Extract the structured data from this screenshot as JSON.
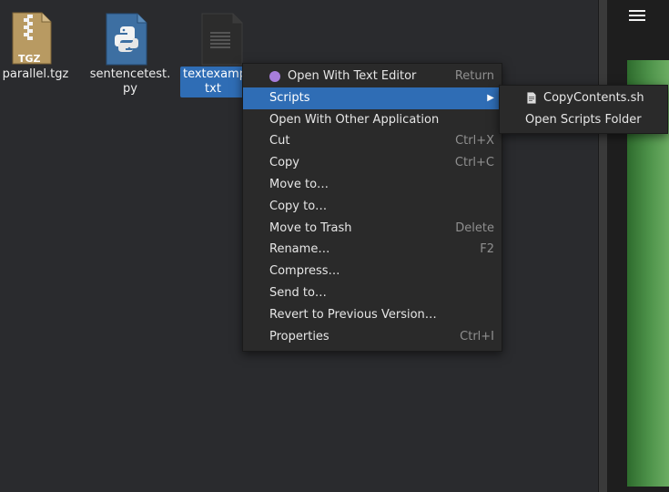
{
  "desktop": {
    "files": [
      {
        "name": "parallel.tgz",
        "badge": "TGZ",
        "icon": "archive-icon"
      },
      {
        "name": "sentencetest.\npy",
        "icon": "python-file-icon"
      },
      {
        "name": "textexamp\ntxt",
        "icon": "text-file-icon",
        "selected": true
      }
    ]
  },
  "top_right_menu_icon": "hamburger-icon",
  "context_menu": {
    "items": [
      {
        "label": "Open With Text Editor",
        "shortcut": "Return",
        "icon": "text-editor-icon"
      },
      {
        "label": "Scripts",
        "submenu": true,
        "active": true
      },
      {
        "label": "Open With Other Application"
      },
      {
        "label": "Cut",
        "shortcut": "Ctrl+X"
      },
      {
        "label": "Copy",
        "shortcut": "Ctrl+C"
      },
      {
        "label": "Move to…"
      },
      {
        "label": "Copy to…"
      },
      {
        "label": "Move to Trash",
        "shortcut": "Delete"
      },
      {
        "label": "Rename…",
        "shortcut": "F2"
      },
      {
        "label": "Compress…"
      },
      {
        "label": "Send to…"
      },
      {
        "label": "Revert to Previous Version…"
      },
      {
        "label": "Properties",
        "shortcut": "Ctrl+I"
      }
    ]
  },
  "scripts_submenu": {
    "items": [
      {
        "label": "CopyContents.sh",
        "icon": "script-file-icon"
      },
      {
        "label": "Open Scripts Folder"
      }
    ]
  },
  "colors": {
    "selection_blue": "#2f6db5",
    "menu_bg": "#2a2a2a",
    "desktop_bg": "#2a2b2e",
    "preview_green": "#4f944b"
  }
}
